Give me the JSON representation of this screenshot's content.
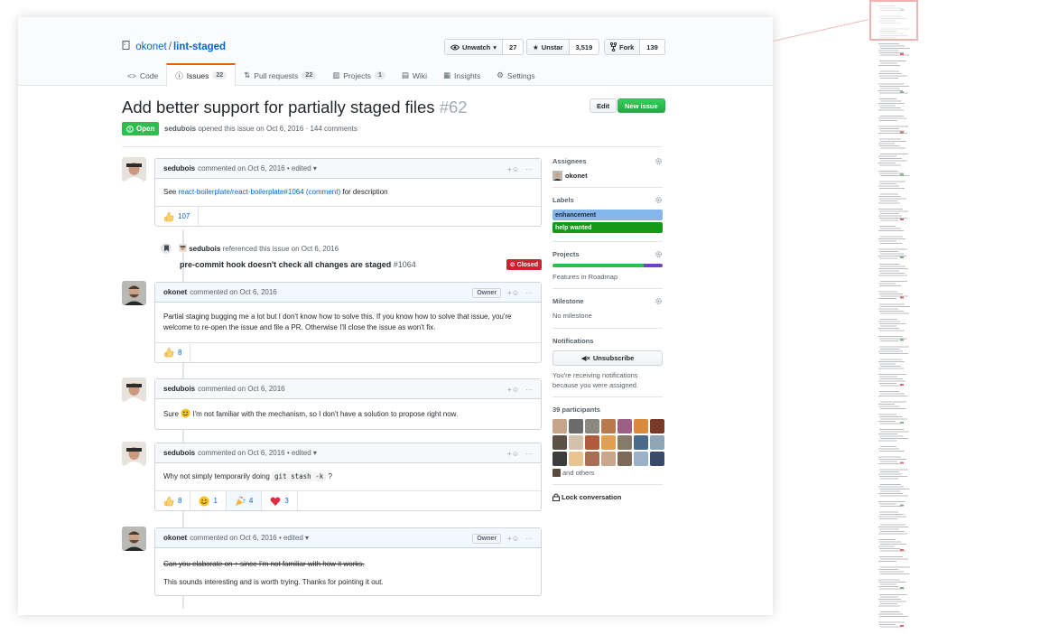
{
  "repo": {
    "owner": "okonet",
    "separator": "/",
    "name": "lint-staged"
  },
  "repo_actions": {
    "watch": {
      "label": "Unwatch",
      "count": "27"
    },
    "star": {
      "label": "Unstar",
      "count": "3,519"
    },
    "fork": {
      "label": "Fork",
      "count": "139"
    }
  },
  "tabs": [
    {
      "label": "Code"
    },
    {
      "label": "Issues",
      "count": "22"
    },
    {
      "label": "Pull requests",
      "count": "22"
    },
    {
      "label": "Projects",
      "count": "1"
    },
    {
      "label": "Wiki"
    },
    {
      "label": "Insights"
    },
    {
      "label": "Settings"
    }
  ],
  "issue": {
    "title": "Add better support for partially staged files",
    "number": "#62",
    "state": "Open",
    "author": "sedubois",
    "meta_text": "opened this issue on Oct 6, 2016 · 144 comments",
    "edit_label": "Edit",
    "new_issue_label": "New issue"
  },
  "comments": [
    {
      "author": "sedubois",
      "meta": "commented on Oct 6, 2016 • edited ▾",
      "body_prefix": "See ",
      "link1": "react-boilerplate/react-boilerplate#1064",
      "link2": "(comment)",
      "body_suffix": " for description",
      "reactions": [
        {
          "emoji": "thumbs-up",
          "count": "107"
        }
      ]
    },
    {
      "author": "okonet",
      "meta": "commented on Oct 6, 2016",
      "badge": "Owner",
      "body": "Partial staging bugging me a lot but I don't know how to solve this. If you know how to solve that issue, you're welcome to re-open the issue and file a PR. Otherwise I'll close the issue as won't fix.",
      "reactions": [
        {
          "emoji": "thumbs-up",
          "count": "8"
        }
      ]
    },
    {
      "author": "sedubois",
      "meta": "commented on Oct 6, 2016",
      "body_prefix": "Sure ",
      "body_suffix": " I'm not familiar with the mechanism, so I don't have a solution to propose right now."
    },
    {
      "author": "sedubois",
      "meta": "commented on Oct 6, 2016 • edited ▾",
      "body_prefix": "Why not simply temporarily doing ",
      "code": "git stash -k",
      "body_suffix": " ?",
      "reactions": [
        {
          "emoji": "thumbs-up",
          "count": "8"
        },
        {
          "emoji": "smile",
          "count": "1"
        },
        {
          "emoji": "tada",
          "count": "4"
        },
        {
          "emoji": "heart",
          "count": "3"
        }
      ]
    },
    {
      "author": "okonet",
      "meta": "commented on Oct 6, 2016 • edited ▾",
      "badge": "Owner",
      "strike": "Can you elaborate on ↑ since I'm not familiar with how it works.",
      "body": "This sounds interesting and is worth trying. Thanks for pointing it out."
    }
  ],
  "reference": {
    "author": "sedubois",
    "text": "referenced this issue on Oct 6, 2016",
    "title": "pre-commit hook doesn't check all changes are staged",
    "number": "#1064",
    "state": "Closed"
  },
  "sidebar": {
    "assignees": {
      "heading": "Assignees",
      "name": "okonet"
    },
    "labels": {
      "heading": "Labels",
      "items": [
        {
          "name": "enhancement",
          "color": "#84b6eb"
        },
        {
          "name": "help wanted",
          "color": "#159818"
        }
      ]
    },
    "projects": {
      "heading": "Projects",
      "name": "Features in Roadmap",
      "progress_green": 0.83,
      "progress_purple": 0.17
    },
    "milestone": {
      "heading": "Milestone",
      "value": "No milestone"
    },
    "notifications": {
      "heading": "Notifications",
      "button": "Unsubscribe",
      "text": "You're receiving notifications because you were assigned."
    },
    "participants": {
      "heading": "39 participants",
      "more": "and others"
    },
    "lock": "Lock conversation"
  },
  "colors": {
    "link": "#0366d6",
    "open_green": "#2cbe4e",
    "closed_red": "#cb2431",
    "tab_accent": "#e36209"
  }
}
